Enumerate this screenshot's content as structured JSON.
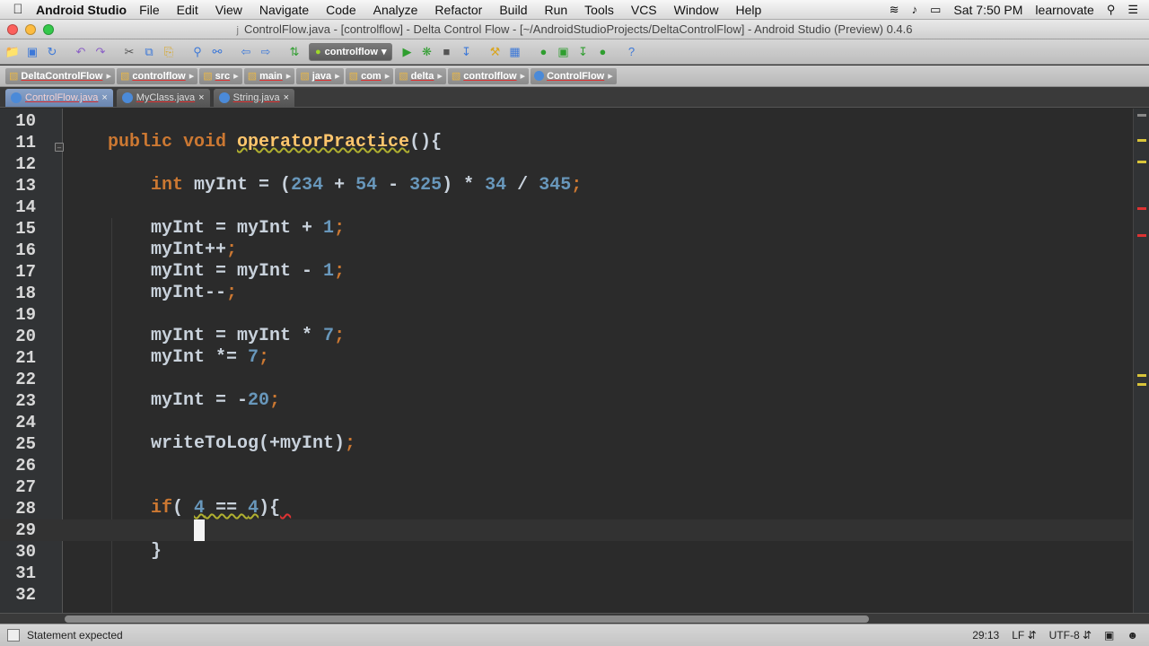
{
  "menubar": {
    "app_name": "Android Studio",
    "items": [
      "File",
      "Edit",
      "View",
      "Navigate",
      "Code",
      "Analyze",
      "Refactor",
      "Build",
      "Run",
      "Tools",
      "VCS",
      "Window",
      "Help"
    ],
    "clock": "Sat 7:50 PM",
    "user": "learnovate"
  },
  "window": {
    "title": "ControlFlow.java - [controlflow] - Delta Control Flow - [~/AndroidStudioProjects/DeltaControlFlow] - Android Studio (Preview) 0.4.6"
  },
  "toolbar": {
    "run_config": "controlflow"
  },
  "breadcrumbs": [
    {
      "label": "DeltaControlFlow",
      "kind": "folder"
    },
    {
      "label": "controlflow",
      "kind": "folder"
    },
    {
      "label": "src",
      "kind": "folder"
    },
    {
      "label": "main",
      "kind": "folder"
    },
    {
      "label": "java",
      "kind": "folder"
    },
    {
      "label": "com",
      "kind": "folder"
    },
    {
      "label": "delta",
      "kind": "folder"
    },
    {
      "label": "controlflow",
      "kind": "folder"
    },
    {
      "label": "ControlFlow",
      "kind": "class"
    }
  ],
  "tabs": [
    {
      "label": "ControlFlow.java",
      "active": true
    },
    {
      "label": "MyClass.java",
      "active": false
    },
    {
      "label": "String.java",
      "active": false
    }
  ],
  "editor": {
    "line_numbers": [
      "10",
      "11",
      "12",
      "13",
      "14",
      "15",
      "16",
      "17",
      "18",
      "19",
      "20",
      "21",
      "22",
      "23",
      "24",
      "25",
      "26",
      "27",
      "28",
      "29",
      "30",
      "31",
      "32"
    ],
    "current_line": "29"
  },
  "status": {
    "message": "Statement expected",
    "position": "29:13",
    "line_sep": "LF",
    "encoding": "UTF-8"
  },
  "colors": {
    "keyword": "#cc7832",
    "number": "#6897bb",
    "method": "#ffc66d",
    "text": "#c9d2dc",
    "background": "#2b2b2b"
  }
}
